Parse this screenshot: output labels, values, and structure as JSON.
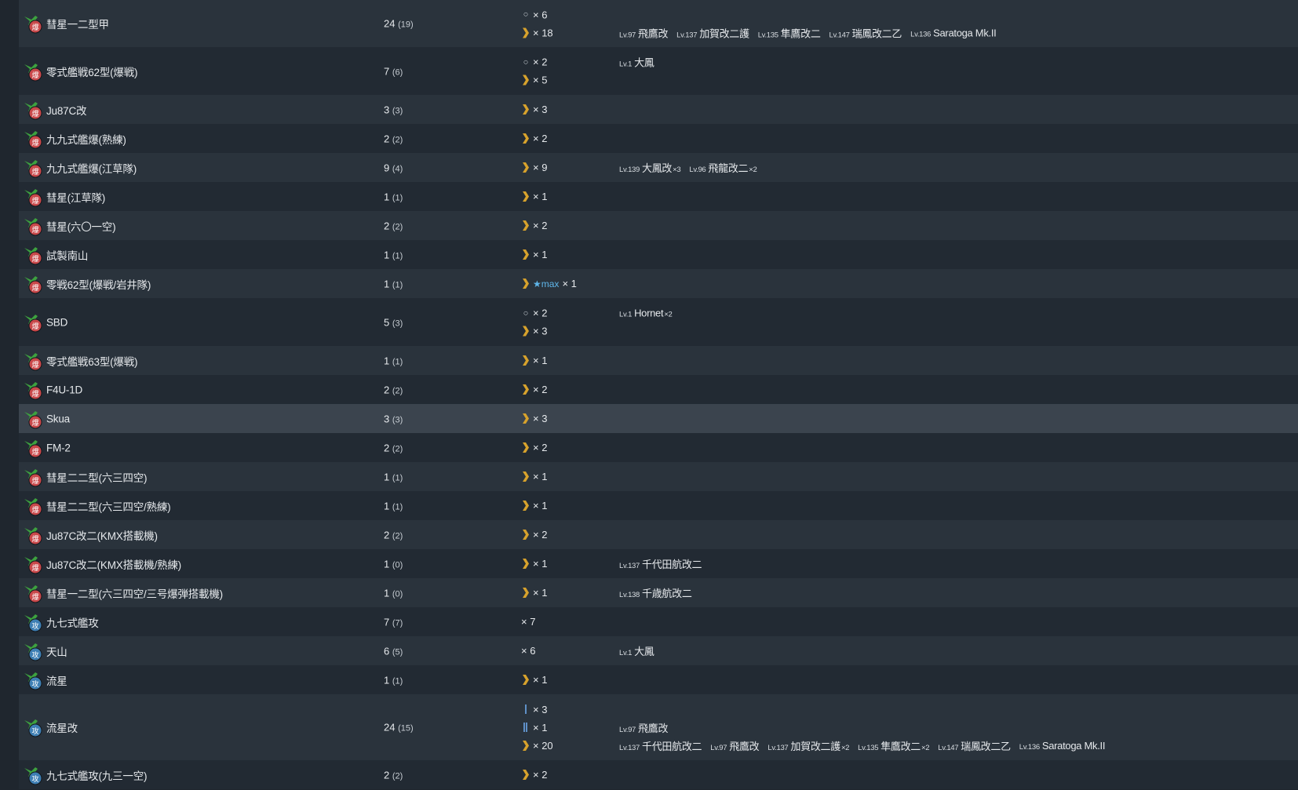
{
  "colors": {
    "bomber_badge": "#c9484a",
    "torpedo_badge": "#3e7fb4",
    "plane_green": "#3da23f",
    "chevron": "#d7a22c",
    "star_max": "#5fb6ea",
    "bar": "#5f90c7"
  },
  "rows": [
    {
      "type": "bomber",
      "badge": "爆",
      "name": "彗星一二型甲",
      "count": "24",
      "sub": "(19)",
      "h": 60,
      "imps": [
        {
          "mark": "circle",
          "text": "× 6"
        },
        {
          "mark": "chevron",
          "text": "× 18"
        }
      ],
      "ships": [
        [],
        [
          {
            "lv": "Lv.97",
            "name": "飛鷹改"
          },
          {
            "lv": "Lv.137",
            "name": "加賀改二護"
          },
          {
            "lv": "Lv.135",
            "name": "隼鷹改二"
          },
          {
            "lv": "Lv.147",
            "name": "瑞鳳改二乙"
          },
          {
            "lv": "Lv.136",
            "name": "Saratoga Mk.II"
          }
        ]
      ]
    },
    {
      "type": "bomber",
      "badge": "爆",
      "name": "零式艦戦62型(爆戦)",
      "count": "7",
      "sub": "(6)",
      "h": 61,
      "imps": [
        {
          "mark": "circle",
          "text": "× 2"
        },
        {
          "mark": "chevron",
          "text": "× 5"
        }
      ],
      "ships": [
        [
          {
            "lv": "Lv.1",
            "name": "大鳳"
          }
        ],
        []
      ]
    },
    {
      "type": "bomber",
      "badge": "爆",
      "name": "Ju87C改",
      "count": "3",
      "sub": "(3)",
      "h": 37,
      "imps": [
        {
          "mark": "chevron",
          "text": "× 3"
        }
      ],
      "ships": []
    },
    {
      "type": "bomber",
      "badge": "爆",
      "name": "九九式艦爆(熟練)",
      "count": "2",
      "sub": "(2)",
      "h": 37,
      "imps": [
        {
          "mark": "chevron",
          "text": "× 2"
        }
      ],
      "ships": []
    },
    {
      "type": "bomber",
      "badge": "爆",
      "name": "九九式艦爆(江草隊)",
      "count": "9",
      "sub": "(4)",
      "h": 37,
      "imps": [
        {
          "mark": "chevron",
          "text": "× 9"
        }
      ],
      "ships": [
        [
          {
            "lv": "Lv.139",
            "name": "大鳳改",
            "mult": "×3"
          },
          {
            "lv": "Lv.96",
            "name": "飛龍改二",
            "mult": "×2"
          }
        ]
      ]
    },
    {
      "type": "bomber",
      "badge": "爆",
      "name": "彗星(江草隊)",
      "count": "1",
      "sub": "(1)",
      "h": 37,
      "imps": [
        {
          "mark": "chevron",
          "text": "× 1"
        }
      ],
      "ships": []
    },
    {
      "type": "bomber",
      "badge": "爆",
      "name": "彗星(六〇一空)",
      "count": "2",
      "sub": "(2)",
      "h": 37,
      "imps": [
        {
          "mark": "chevron",
          "text": "× 2"
        }
      ],
      "ships": []
    },
    {
      "type": "bomber",
      "badge": "爆",
      "name": "試製南山",
      "count": "1",
      "sub": "(1)",
      "h": 37,
      "imps": [
        {
          "mark": "chevron",
          "text": "× 1"
        }
      ],
      "ships": []
    },
    {
      "type": "bomber",
      "badge": "爆",
      "name": "零戦62型(爆戦/岩井隊)",
      "count": "1",
      "sub": "(1)",
      "h": 37,
      "imps": [
        {
          "mark": "chevron",
          "star": "★max",
          "text": "× 1"
        }
      ],
      "ships": []
    },
    {
      "type": "bomber",
      "badge": "爆",
      "name": "SBD",
      "count": "5",
      "sub": "(3)",
      "h": 61,
      "imps": [
        {
          "mark": "circle",
          "text": "× 2"
        },
        {
          "mark": "chevron",
          "text": "× 3"
        }
      ],
      "ships": [
        [
          {
            "lv": "Lv.1",
            "name": "Hornet",
            "mult": "×2"
          }
        ],
        []
      ]
    },
    {
      "type": "bomber",
      "badge": "爆",
      "name": "零式艦戦63型(爆戦)",
      "count": "1",
      "sub": "(1)",
      "h": 37,
      "imps": [
        {
          "mark": "chevron",
          "text": "× 1"
        }
      ],
      "ships": []
    },
    {
      "type": "bomber",
      "badge": "爆",
      "name": "F4U-1D",
      "count": "2",
      "sub": "(2)",
      "h": 37,
      "imps": [
        {
          "mark": "chevron",
          "text": "× 2"
        }
      ],
      "ships": []
    },
    {
      "type": "bomber",
      "badge": "爆",
      "name": "Skua",
      "count": "3",
      "sub": "(3)",
      "h": 37,
      "hl": true,
      "imps": [
        {
          "mark": "chevron",
          "text": "× 3"
        }
      ],
      "ships": []
    },
    {
      "type": "bomber",
      "badge": "爆",
      "name": "FM-2",
      "count": "2",
      "sub": "(2)",
      "h": 37,
      "imps": [
        {
          "mark": "chevron",
          "text": "× 2"
        }
      ],
      "ships": []
    },
    {
      "type": "bomber",
      "badge": "爆",
      "name": "彗星二二型(六三四空)",
      "count": "1",
      "sub": "(1)",
      "h": 37,
      "imps": [
        {
          "mark": "chevron",
          "text": "× 1"
        }
      ],
      "ships": []
    },
    {
      "type": "bomber",
      "badge": "爆",
      "name": "彗星二二型(六三四空/熟練)",
      "count": "1",
      "sub": "(1)",
      "h": 37,
      "imps": [
        {
          "mark": "chevron",
          "text": "× 1"
        }
      ],
      "ships": []
    },
    {
      "type": "bomber",
      "badge": "爆",
      "name": "Ju87C改二(KMX搭載機)",
      "count": "2",
      "sub": "(2)",
      "h": 37,
      "imps": [
        {
          "mark": "chevron",
          "text": "× 2"
        }
      ],
      "ships": []
    },
    {
      "type": "bomber",
      "badge": "爆",
      "name": "Ju87C改二(KMX搭載機/熟練)",
      "count": "1",
      "sub": "(0)",
      "h": 37,
      "imps": [
        {
          "mark": "chevron",
          "text": "× 1"
        }
      ],
      "ships": [
        [
          {
            "lv": "Lv.137",
            "name": "千代田航改二"
          }
        ]
      ]
    },
    {
      "type": "bomber",
      "badge": "爆",
      "name": "彗星一二型(六三四空/三号爆弾搭載機)",
      "count": "1",
      "sub": "(0)",
      "h": 37,
      "imps": [
        {
          "mark": "chevron",
          "text": "× 1"
        }
      ],
      "ships": [
        [
          {
            "lv": "Lv.138",
            "name": "千歳航改二"
          }
        ]
      ]
    },
    {
      "type": "torpedo",
      "badge": "攻",
      "name": "九七式艦攻",
      "count": "7",
      "sub": "(7)",
      "h": 37,
      "imps": [
        {
          "mark": "none",
          "text": "× 7"
        }
      ],
      "ships": []
    },
    {
      "type": "torpedo",
      "badge": "攻",
      "name": "天山",
      "count": "6",
      "sub": "(5)",
      "h": 37,
      "imps": [
        {
          "mark": "none",
          "text": "× 6"
        }
      ],
      "ships": [
        [
          {
            "lv": "Lv.1",
            "name": "大鳳"
          }
        ]
      ]
    },
    {
      "type": "torpedo",
      "badge": "攻",
      "name": "流星",
      "count": "1",
      "sub": "(1)",
      "h": 37,
      "imps": [
        {
          "mark": "chevron",
          "text": "× 1"
        }
      ],
      "ships": []
    },
    {
      "type": "torpedo",
      "badge": "攻",
      "name": "流星改",
      "count": "24",
      "sub": "(15)",
      "h": 84,
      "imps": [
        {
          "mark": "bar1",
          "text": "× 3"
        },
        {
          "mark": "bar2",
          "text": "× 1"
        },
        {
          "mark": "chevron",
          "text": "× 20"
        }
      ],
      "ships": [
        [],
        [
          {
            "lv": "Lv.97",
            "name": "飛鷹改"
          }
        ],
        [
          {
            "lv": "Lv.137",
            "name": "千代田航改二"
          },
          {
            "lv": "Lv.97",
            "name": "飛鷹改"
          },
          {
            "lv": "Lv.137",
            "name": "加賀改二護",
            "mult": "×2"
          },
          {
            "lv": "Lv.135",
            "name": "隼鷹改二",
            "mult": "×2"
          },
          {
            "lv": "Lv.147",
            "name": "瑞鳳改二乙"
          },
          {
            "lv": "Lv.136",
            "name": "Saratoga Mk.II"
          }
        ]
      ]
    },
    {
      "type": "torpedo",
      "badge": "攻",
      "name": "九七式艦攻(九三一空)",
      "count": "2",
      "sub": "(2)",
      "h": 37,
      "imps": [
        {
          "mark": "chevron",
          "text": "× 2"
        }
      ],
      "ships": []
    }
  ]
}
